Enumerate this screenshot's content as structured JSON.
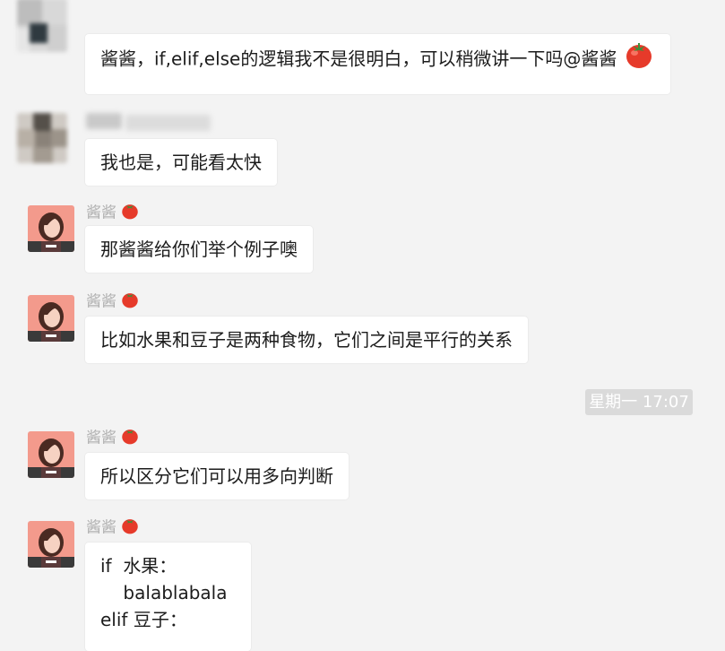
{
  "messages": [
    {
      "sender": "",
      "text": "酱酱，if,elif,else的逻辑我不是很明白，可以稍微讲一下吗@酱酱"
    },
    {
      "sender": "",
      "text": "我也是，可能看太快"
    },
    {
      "sender": "酱酱",
      "text": "那酱酱给你们举个例子噢"
    },
    {
      "sender": "酱酱",
      "text": "比如水果和豆子是两种食物，它们之间是平行的关系"
    },
    {
      "sender": "酱酱",
      "text": "所以区分它们可以用多向判断"
    },
    {
      "sender": "酱酱",
      "lines": [
        "if  水果：",
        "    balablabala",
        "elif 豆子："
      ]
    }
  ],
  "timestamp": "星期一 17:07",
  "colors": {
    "background": "#f3f3f3",
    "bubble": "#ffffff",
    "timestamp_bg": "#dadada",
    "name": "#b0b0b0"
  }
}
